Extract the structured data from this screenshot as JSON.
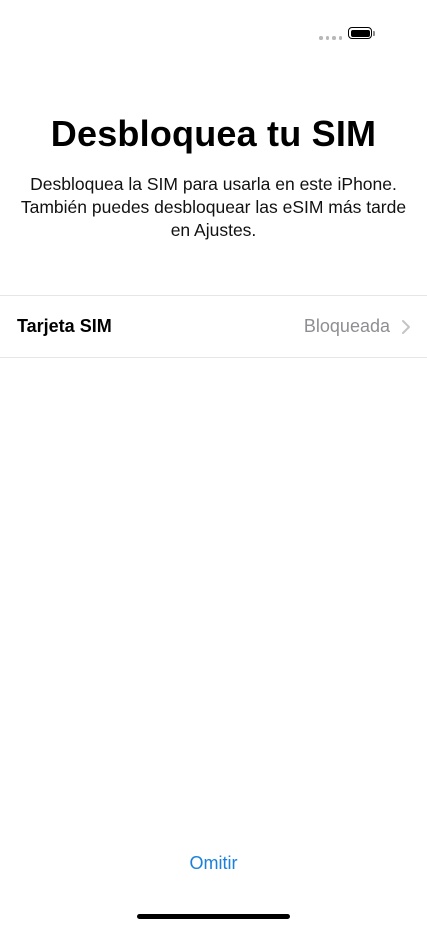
{
  "status_bar": {
    "signal_icon": "signal-dots-icon",
    "battery_icon": "battery-icon"
  },
  "screen": {
    "title": "Desbloquea tu SIM",
    "description": "Desbloquea la SIM para usarla en este iPhone. También puedes desbloquear las eSIM más tarde en Ajustes."
  },
  "sim_row": {
    "label": "Tarjeta SIM",
    "value": "Bloqueada",
    "icon": "chevron-right-icon"
  },
  "footer": {
    "skip_label": "Omitir"
  },
  "colors": {
    "accent": "#1a80d9",
    "secondary_text": "#8e8e93",
    "separator": "#e6e6e6"
  }
}
